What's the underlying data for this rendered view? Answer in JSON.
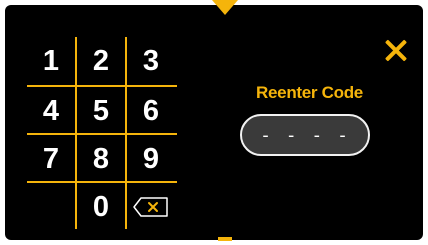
{
  "keypad": {
    "keys": [
      "1",
      "2",
      "3",
      "4",
      "5",
      "6",
      "7",
      "8",
      "9",
      "0"
    ]
  },
  "prompt": {
    "title": "Reenter Code"
  },
  "code_field": {
    "value": "- - - -"
  },
  "colors": {
    "accent": "#f5b40b",
    "panel": "#000000",
    "field": "#3a3a3a",
    "text": "#ffffff"
  },
  "icons": {
    "close": "close-icon",
    "backspace": "backspace-icon",
    "top_tab": "caret-down-icon",
    "bottom_tab": "bottom-tab-indicator"
  }
}
